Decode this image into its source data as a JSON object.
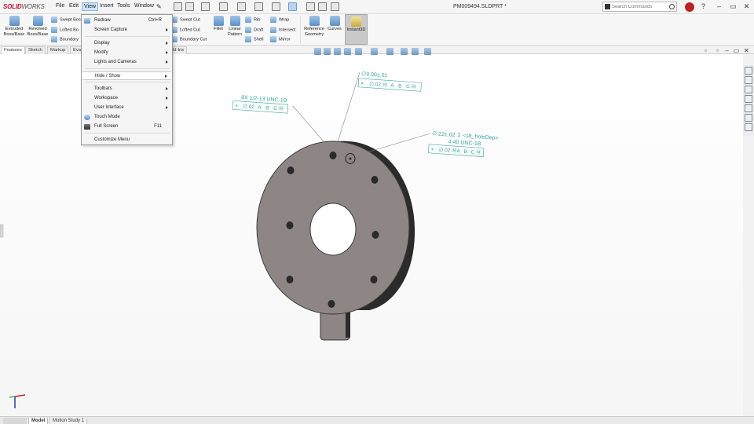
{
  "app": {
    "logo_text_1": "SOLID",
    "logo_text_2": "WORKS",
    "document_title": "PM009494.SLDPRT *"
  },
  "menubar": {
    "items": [
      "File",
      "Edit",
      "View",
      "Insert",
      "Tools",
      "Window"
    ],
    "active": "View"
  },
  "search": {
    "placeholder": "Search Commands"
  },
  "title_buttons": [
    "?",
    "–",
    "▭",
    "✕"
  ],
  "ribbon": {
    "features_left": [
      {
        "label_1": "Extruded",
        "label_2": "Boss/Base"
      },
      {
        "label_1": "Revolved",
        "label_2": "Boss/Base"
      }
    ],
    "features_small_col1": [
      "Swept Boss",
      "Lofted Bo",
      "Boundary"
    ],
    "features_small_col2": [
      "Swept Cut",
      "Lofted Cut",
      "Boundary Cut"
    ],
    "fillet": "Fillet",
    "linear_pattern_1": "Linear",
    "linear_pattern_2": "Pattern",
    "small_col3": [
      "Rib",
      "Draft",
      "Shell"
    ],
    "small_col4": [
      "Wrap",
      "Intersect",
      "Mirror"
    ],
    "reference_geometry_1": "Reference",
    "reference_geometry_2": "Geometry",
    "curves": "Curves",
    "instant3d": "Instant3D"
  },
  "tabs": [
    "Features",
    "Sketch",
    "Markup",
    "Eval",
    "ld-Ins"
  ],
  "view_menu": {
    "items": [
      {
        "label": "Redraw",
        "shortcut": "Ctrl+R",
        "submenu": false,
        "icon": "redraw-icon"
      },
      {
        "label": "Screen Capture",
        "shortcut": "",
        "submenu": true,
        "icon": ""
      },
      {
        "label": "Display",
        "shortcut": "",
        "submenu": true,
        "icon": ""
      },
      {
        "label": "Modify",
        "shortcut": "",
        "submenu": true,
        "icon": ""
      },
      {
        "label": "Lights and Cameras",
        "shortcut": "",
        "submenu": true,
        "icon": ""
      },
      {
        "label": "Hide / Show",
        "shortcut": "",
        "submenu": true,
        "icon": "",
        "highlighted": true
      },
      {
        "label": "Toolbars",
        "shortcut": "",
        "submenu": true,
        "icon": ""
      },
      {
        "label": "Workspace",
        "shortcut": "",
        "submenu": true,
        "icon": ""
      },
      {
        "label": "User Interface",
        "shortcut": "",
        "submenu": true,
        "icon": ""
      },
      {
        "label": "Touch Mode",
        "shortcut": "",
        "submenu": false,
        "icon": "touch-mode-icon"
      },
      {
        "label": "Full Screen",
        "shortcut": "F11",
        "submenu": false,
        "icon": "full-screen-icon"
      },
      {
        "label": "Customize Menu",
        "shortcut": "",
        "submenu": false,
        "icon": ""
      }
    ]
  },
  "annotations": {
    "top_dim": "∅9.00±.01",
    "top_fcf": [
      "⌖",
      "∅.02 Ⓜ",
      "A",
      "B",
      "C Ⓜ"
    ],
    "left_note": "8X 1/2-13 UNC-1B",
    "left_fcf": [
      "⌖",
      "∅.02",
      "A",
      "B",
      "C Ⓜ"
    ],
    "right_note_1": "∅.22±.02 ↧ <sft_holeDep>",
    "right_note_2": "4-40 UNC-1B",
    "right_fcf": [
      "⌖",
      "∅.02 Ⓜ",
      "A",
      "B",
      "C Ⓜ"
    ]
  },
  "bottom_tabs": [
    "Model",
    "Motion Study 1"
  ],
  "colors": {
    "annotation": "#3aa59b",
    "part_face": "#8e8585",
    "part_side": "#2b2b2b",
    "brand": "#c8102e"
  }
}
